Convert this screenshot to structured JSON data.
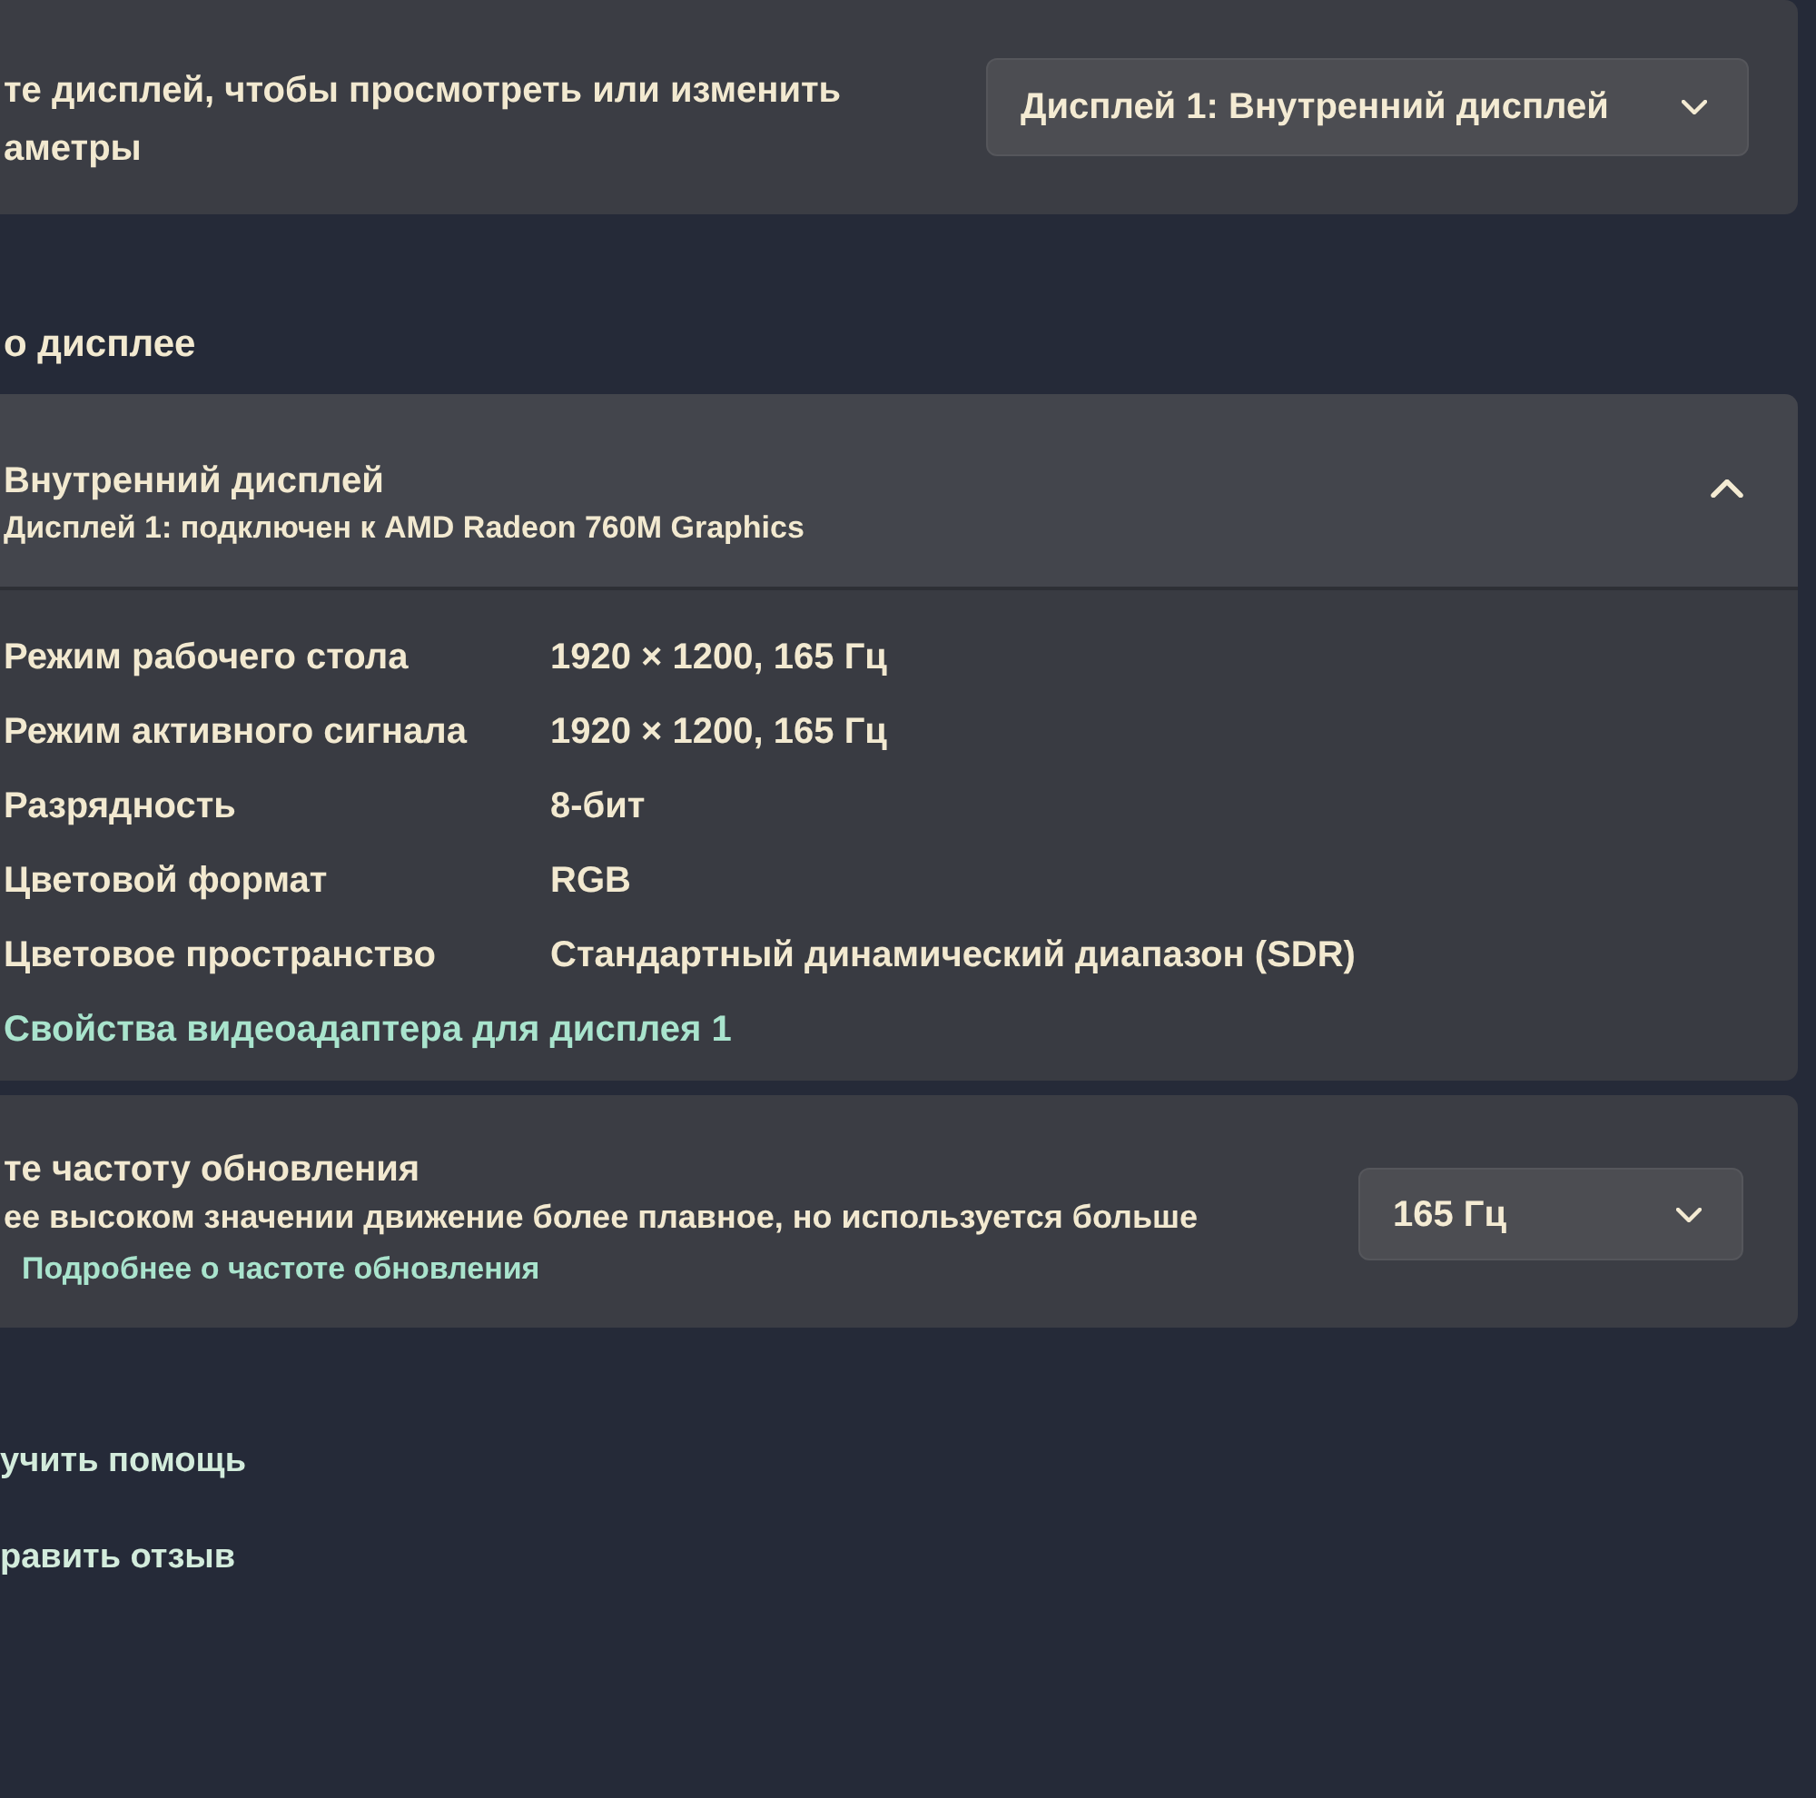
{
  "display_picker": {
    "description_lines": [
      "те дисплей, чтобы просмотреть или изменить",
      "аметры"
    ],
    "dropdown": {
      "value": "Дисплей 1: Внутренний дисплей"
    }
  },
  "section_heading": "о дисплее",
  "display_info": {
    "title": "Внутренний дисплей",
    "subtitle": "Дисплей 1: подключен к AMD Radeon 760M Graphics",
    "expanded": true,
    "rows": [
      {
        "label": "Режим рабочего стола",
        "value": "1920 × 1200, 165 Гц"
      },
      {
        "label": "Режим активного сигнала",
        "value": "1920 × 1200, 165 Гц"
      },
      {
        "label": "Разрядность",
        "value": "8-бит"
      },
      {
        "label": "Цветовой формат",
        "value": "RGB"
      },
      {
        "label": "Цветовое пространство",
        "value": "Стандартный динамический диапазон (SDR)"
      }
    ],
    "link": "Свойства видеоадаптера для дисплея 1"
  },
  "refresh_rate": {
    "title": "те частоту обновления",
    "description": "ее высоком значении движение более плавное, но используется больше",
    "link": "Подробнее о частоте обновления",
    "dropdown": {
      "value": "165 Гц"
    }
  },
  "help_links": [
    "учить помощь",
    "равить отзыв"
  ]
}
